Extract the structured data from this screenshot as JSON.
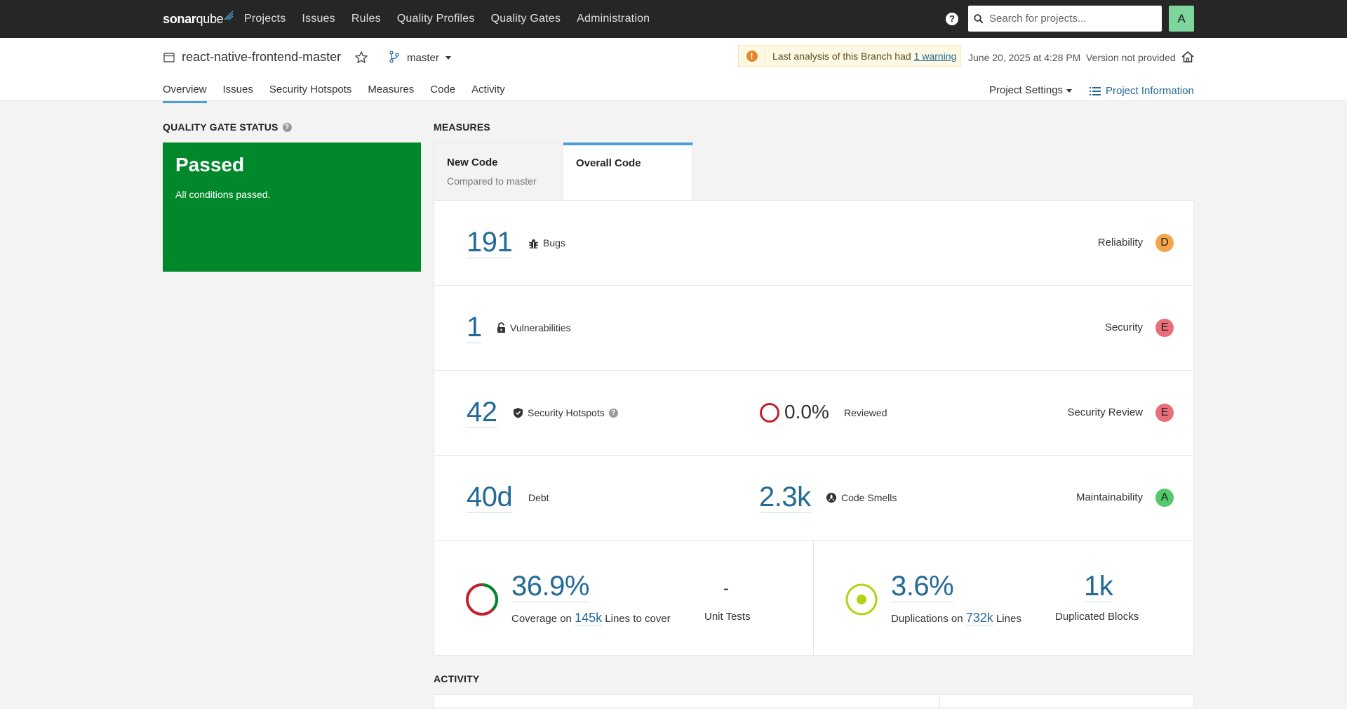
{
  "topnav": {
    "logo_sonar": "sonar",
    "logo_qube": "qube",
    "links": [
      "Projects",
      "Issues",
      "Rules",
      "Quality Profiles",
      "Quality Gates",
      "Administration"
    ],
    "help_icon": "?",
    "search_placeholder": "Search for projects...",
    "avatar": "A"
  },
  "project": {
    "name": "react-native-frontend-master",
    "branch": "master",
    "warning_text": "Last analysis of this Branch had",
    "warning_link": "1 warning",
    "analysis_date": "June 20, 2025 at 4:28 PM",
    "version": "Version not provided",
    "tabs": [
      "Overview",
      "Issues",
      "Security Hotspots",
      "Measures",
      "Code",
      "Activity"
    ],
    "active_tab": "Overview",
    "settings_label": "Project Settings",
    "info_label": "Project Information"
  },
  "quality_gate": {
    "title": "QUALITY GATE STATUS",
    "status": "Passed",
    "subtitle": "All conditions passed.",
    "color": "#00882b"
  },
  "measures": {
    "title": "MEASURES",
    "tab_new_title": "New Code",
    "tab_new_sub": "Compared to master",
    "tab_overall_title": "Overall Code",
    "bugs": {
      "value": "191",
      "label": "Bugs",
      "rating_label": "Reliability",
      "rating": "D"
    },
    "vulnerabilities": {
      "value": "1",
      "label": "Vulnerabilities",
      "rating_label": "Security",
      "rating": "E"
    },
    "hotspots": {
      "value": "42",
      "label": "Security Hotspots",
      "reviewed_pct": "0.0%",
      "reviewed_label": "Reviewed",
      "rating_label": "Security Review",
      "rating": "E"
    },
    "maintainability": {
      "debt_value": "40d",
      "debt_label": "Debt",
      "smells_value": "2.3k",
      "smells_label": "Code Smells",
      "rating_label": "Maintainability",
      "rating": "A"
    },
    "coverage": {
      "value": "36.9%",
      "fraction": 0.369,
      "prefix": "Coverage on",
      "lines": "145k",
      "suffix": "Lines to cover",
      "unit_tests_value": "-",
      "unit_tests_label": "Unit Tests"
    },
    "duplications": {
      "value": "3.6%",
      "prefix": "Duplications on",
      "lines": "732k",
      "suffix": "Lines",
      "blocks_value": "1k",
      "blocks_label": "Duplicated Blocks"
    }
  },
  "activity": {
    "title": "ACTIVITY"
  }
}
